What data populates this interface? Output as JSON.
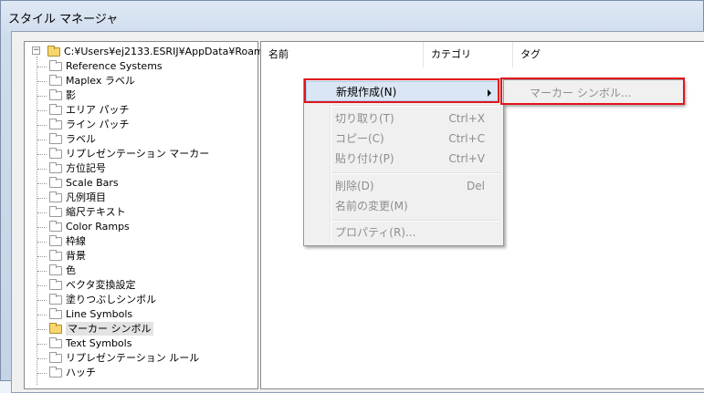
{
  "window": {
    "title": "スタイル マネージャ"
  },
  "tree": {
    "root_label": "C:¥Users¥ej2133.ESRIJ¥AppData¥Roam",
    "items": [
      {
        "label": "Reference Systems",
        "selected": false
      },
      {
        "label": "Maplex ラベル",
        "selected": false
      },
      {
        "label": "影",
        "selected": false
      },
      {
        "label": "エリア パッチ",
        "selected": false
      },
      {
        "label": "ライン パッチ",
        "selected": false
      },
      {
        "label": "ラベル",
        "selected": false
      },
      {
        "label": "リプレゼンテーション マーカー",
        "selected": false
      },
      {
        "label": "方位記号",
        "selected": false
      },
      {
        "label": "Scale Bars",
        "selected": false
      },
      {
        "label": "凡例項目",
        "selected": false
      },
      {
        "label": "縮尺テキスト",
        "selected": false
      },
      {
        "label": "Color Ramps",
        "selected": false
      },
      {
        "label": "枠線",
        "selected": false
      },
      {
        "label": "背景",
        "selected": false
      },
      {
        "label": "色",
        "selected": false
      },
      {
        "label": "ベクタ変換設定",
        "selected": false
      },
      {
        "label": "塗りつぶしシンボル",
        "selected": false
      },
      {
        "label": "Line Symbols",
        "selected": false
      },
      {
        "label": "マーカー シンボル",
        "selected": true
      },
      {
        "label": "Text Symbols",
        "selected": false
      },
      {
        "label": "リプレゼンテーション ルール",
        "selected": false
      },
      {
        "label": "ハッチ",
        "selected": false
      }
    ]
  },
  "list": {
    "columns": [
      "名前",
      "カテゴリ",
      "タグ"
    ]
  },
  "context_menu": {
    "new": "新規作成(N)",
    "cut": "切り取り(T)",
    "cut_shortcut": "Ctrl+X",
    "copy": "コピー(C)",
    "copy_shortcut": "Ctrl+C",
    "paste": "貼り付け(P)",
    "paste_shortcut": "Ctrl+V",
    "delete": "削除(D)",
    "delete_shortcut": "Del",
    "rename": "名前の変更(M)",
    "properties": "プロパティ(R)..."
  },
  "submenu": {
    "marker_symbol": "マーカー シンボル..."
  },
  "colors": {
    "highlight": "#e2141b",
    "menu_hot": "#dbe6f4"
  }
}
